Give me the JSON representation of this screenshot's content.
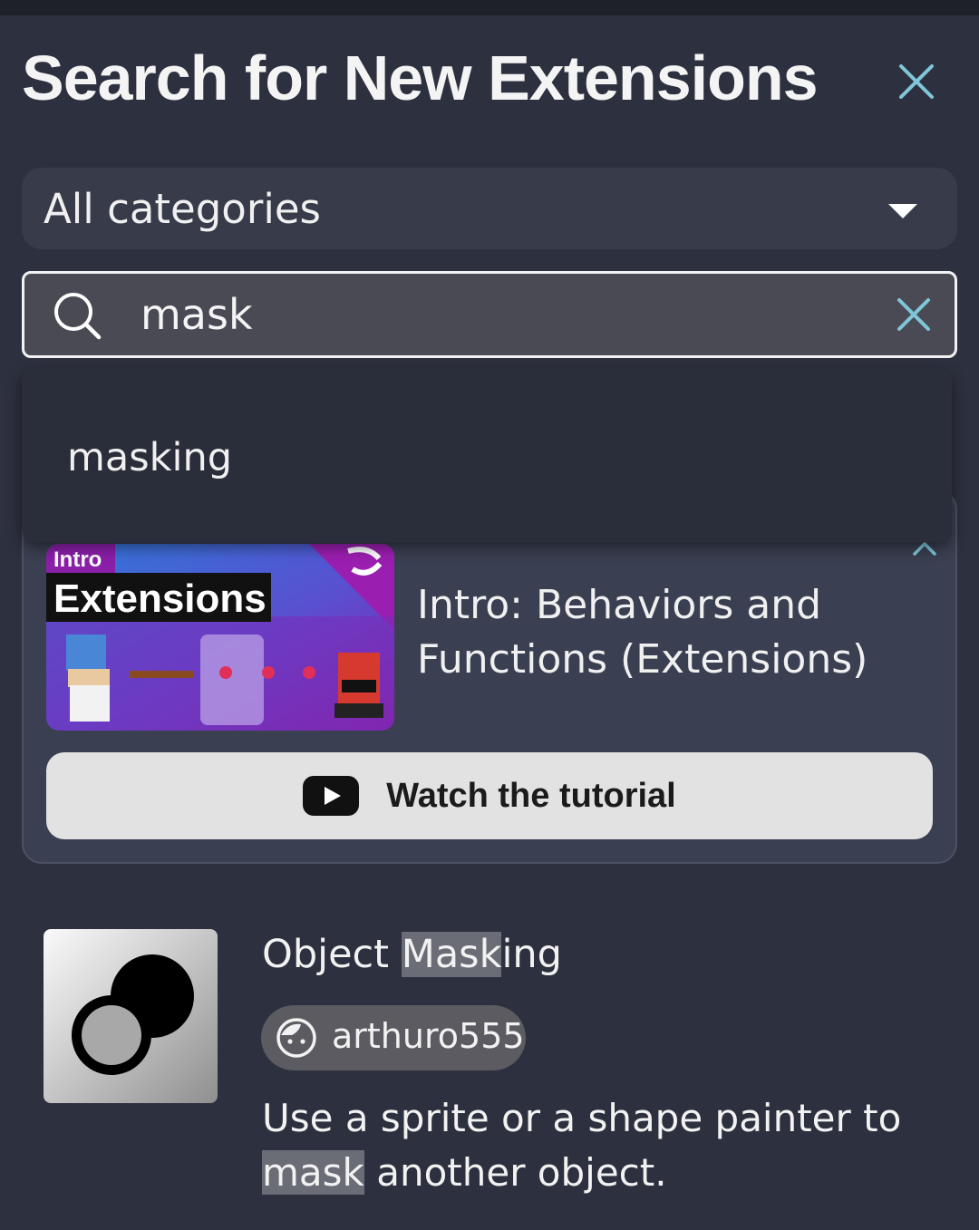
{
  "dialog": {
    "title": "Search for New Extensions",
    "close_icon": "close-icon"
  },
  "category": {
    "selected": "All categories",
    "icon": "caret-down-icon"
  },
  "search": {
    "value": "mask",
    "icon": "search-icon",
    "clear_icon": "clear-icon"
  },
  "suggestions": [
    "masking"
  ],
  "tutorial": {
    "thumb_badge": "Intro",
    "thumb_heading": "Extensions",
    "title": "Intro: Behaviors and Functions (Extensions)",
    "button_label": "Watch the tutorial",
    "button_icon": "youtube-icon",
    "collapse_icon": "chevron-up-icon"
  },
  "extension": {
    "name_before": "Object ",
    "name_match": "Mask",
    "name_after": "ing",
    "author": "arthuro555",
    "author_icon": "avatar-icon",
    "desc_before": "Use a sprite or a shape painter to ",
    "desc_match": "mask",
    "desc_after": " another object."
  },
  "colors": {
    "background": "#2d303e",
    "card": "#3a3f51",
    "accent": "#7fc6d8",
    "highlight": "#6a6c76",
    "thumb_purple": "#8a1fa8",
    "thumb_blue": "#2f6fd6"
  }
}
